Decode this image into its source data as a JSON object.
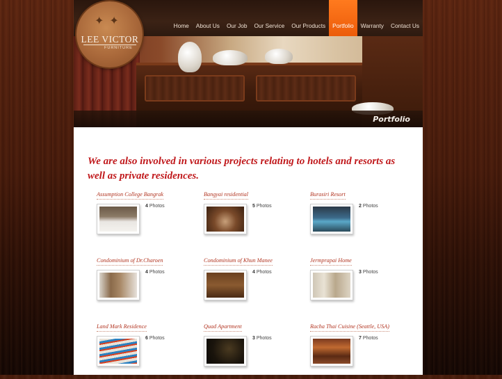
{
  "brand": {
    "name": "LEE VICTOR",
    "tagline": "FURNITURE"
  },
  "nav": [
    {
      "label": "Home",
      "active": false
    },
    {
      "label": "About Us",
      "active": false
    },
    {
      "label": "Our Job",
      "active": false
    },
    {
      "label": "Our Service",
      "active": false
    },
    {
      "label": "Our Products",
      "active": false
    },
    {
      "label": "Portfolio",
      "active": true
    },
    {
      "label": "Warranty",
      "active": false
    },
    {
      "label": "Contact Us",
      "active": false
    }
  ],
  "banner": {
    "caption": "Portfolio"
  },
  "intro": "We are also involved in various projects relating to hotels and resorts as well as private residences.",
  "photos_word": "Photos",
  "projects": [
    {
      "title": "Assumption College Bangrak",
      "count": "4"
    },
    {
      "title": "Bangyai residential",
      "count": "5"
    },
    {
      "title": "Burasiri Resort",
      "count": "2"
    },
    {
      "title": "Condominium of Dr.Charoen",
      "count": "4"
    },
    {
      "title": "Condominium of Khun Manee",
      "count": "4"
    },
    {
      "title": "Jermprapai Home",
      "count": "3"
    },
    {
      "title": "Land Mark Residence",
      "count": "6"
    },
    {
      "title": "Quad Apartment",
      "count": "3"
    },
    {
      "title": "Racha Thai Cuisine (Seattle, USA)",
      "count": "7"
    }
  ],
  "colors": {
    "accent": "#ec5c0a",
    "heading": "#c0181b",
    "link": "#b1331f"
  }
}
